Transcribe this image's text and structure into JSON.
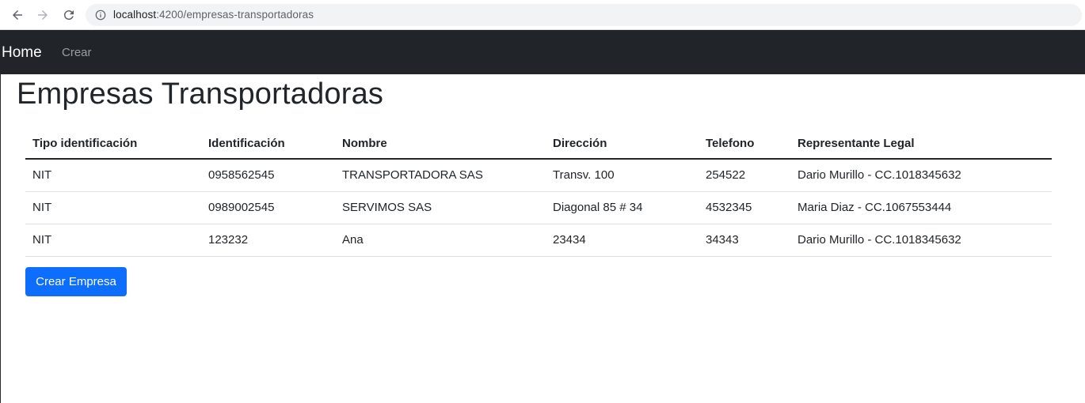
{
  "browser": {
    "url_host": "localhost",
    "url_rest": ":4200/empresas-transportadoras",
    "icons": {
      "back": "arrow-left-icon",
      "forward": "arrow-right-icon",
      "reload": "reload-icon",
      "info": "info-icon"
    }
  },
  "navbar": {
    "brand": "Home",
    "links": [
      "Crear"
    ],
    "background": "#212529"
  },
  "page": {
    "title": "Empresas Transportadoras"
  },
  "table": {
    "headers": [
      "Tipo identificación",
      "Identificación",
      "Nombre",
      "Dirección",
      "Telefono",
      "Representante Legal"
    ],
    "rows": [
      [
        "NIT",
        "0958562545",
        "TRANSPORTADORA SAS",
        "Transv. 100",
        "254522",
        "Dario Murillo - CC.1018345632"
      ],
      [
        "NIT",
        "0989002545",
        "SERVIMOS SAS",
        "Diagonal 85 # 34",
        "4532345",
        "Maria Diaz - CC.1067553444"
      ],
      [
        "NIT",
        "123232",
        "Ana",
        "23434",
        "34343",
        "Dario Murillo - CC.1018345632"
      ]
    ]
  },
  "actions": {
    "create_button": "Crear Empresa",
    "accent": "#0d6efd"
  }
}
